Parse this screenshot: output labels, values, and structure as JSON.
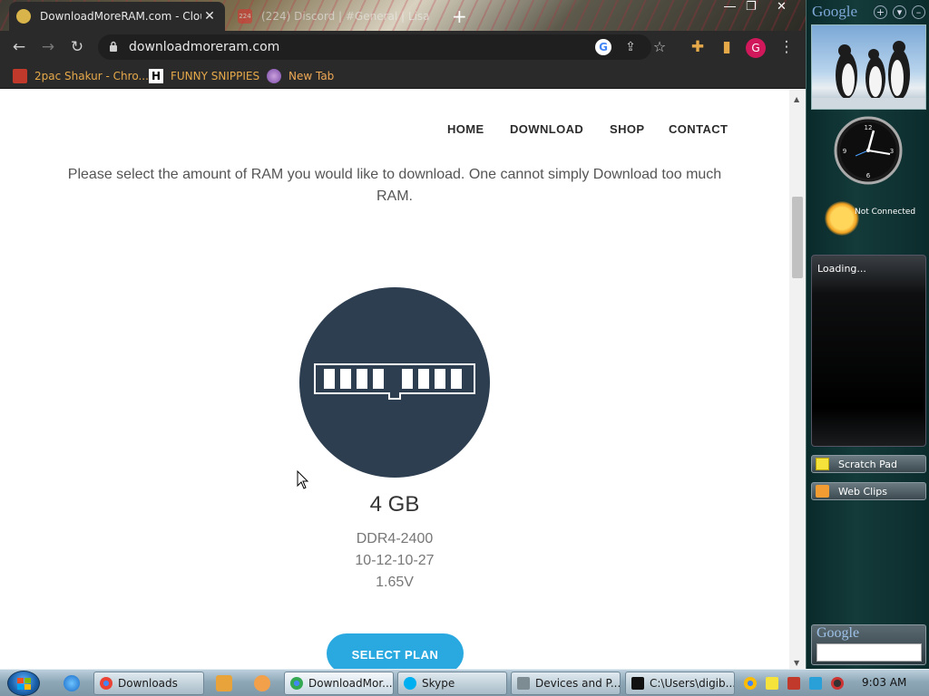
{
  "browser": {
    "tabs": [
      {
        "label": "DownloadMoreRAM.com - Clou",
        "active": true
      },
      {
        "label": "(224) Discord | #General | Lisa C",
        "badge": "224",
        "active": false
      }
    ],
    "url": "downloadmoreram.com",
    "profile_initial": "G",
    "bookmarks": [
      {
        "label": "2pac Shakur - Chro...",
        "icon": "generic-bookmark-icon"
      },
      {
        "label": "FUNNY SNIPPIES",
        "icon": "h-bookmark-icon"
      },
      {
        "label": "New Tab",
        "icon": "globe-icon"
      }
    ]
  },
  "site": {
    "nav": [
      "HOME",
      "DOWNLOAD",
      "SHOP",
      "CONTACT"
    ],
    "intro": "Please select the amount of RAM you would like to download. One cannot simply Download too much RAM.",
    "plan": {
      "size": "4 GB",
      "specs": [
        "DDR4-2400",
        "10-12-10-27",
        "1.65V"
      ],
      "button": "SELECT PLAN"
    }
  },
  "sidebar": {
    "title": "Google",
    "weather_status": "Not Connected",
    "feed_status": "Loading...",
    "gadgets": [
      "Scratch Pad",
      "Web Clips"
    ],
    "search_logo": "Google"
  },
  "taskbar": {
    "tasks": [
      {
        "label": "Downloads"
      },
      {
        "label": "DownloadMor..."
      },
      {
        "label": "Skype"
      },
      {
        "label": "Devices and P..."
      },
      {
        "label": "C:\\Users\\digib..."
      }
    ],
    "time": "9:03 AM"
  },
  "colors": {
    "page_accent": "#2aa9e0",
    "ram_circle": "#2c3e50",
    "profile": "#d0185a",
    "bookmark_text": "#e6a94a"
  }
}
